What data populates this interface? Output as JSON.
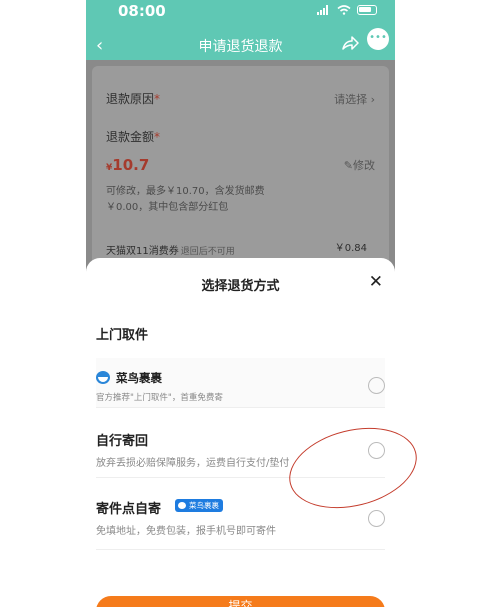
{
  "status_bar": {
    "time": "08:00"
  },
  "nav": {
    "back_glyph": "‹",
    "title": "申请退货退款",
    "share_icon": "share-icon",
    "more_icon": "more-icon"
  },
  "refund_form": {
    "reason_label": "退款原因",
    "required_mark": "*",
    "reason_placeholder": "请选择 ›",
    "amount_label": "退款金额",
    "amount_currency": "¥",
    "amount_value": "10.7",
    "edit_label": "修改",
    "note_line1": "可修改，最多￥10.70，含发货邮费",
    "note_line2": "￥0.00，其中包含部分红包",
    "coupon_name": "天猫双11消费券",
    "coupon_note": "退回后不可用",
    "coupon_value": "￥0.84"
  },
  "sheet": {
    "title": "选择退货方式",
    "close_glyph": "✕",
    "section_title": "上门取件",
    "options": [
      {
        "title": "菜鸟裹裹",
        "subtitle": "官方推荐\"上门取件\"，首重免费寄",
        "logo_icon": "cainiao-logo-icon",
        "selected": false
      },
      {
        "title": "自行寄回",
        "subtitle": "放弃丢损必赔保障服务，运费自行支付/垫付",
        "selected": false
      },
      {
        "title": "寄件点自寄",
        "badge": "菜鸟裹裹",
        "subtitle": "免填地址，免费包装，报手机号即可寄件",
        "selected": false
      }
    ],
    "submit_label": "提交"
  },
  "colors": {
    "header": "#5fc8b4",
    "accent_orange": "#f57b1b",
    "price_red": "#a53b2d",
    "annotation_circle": "#c43c2c"
  }
}
